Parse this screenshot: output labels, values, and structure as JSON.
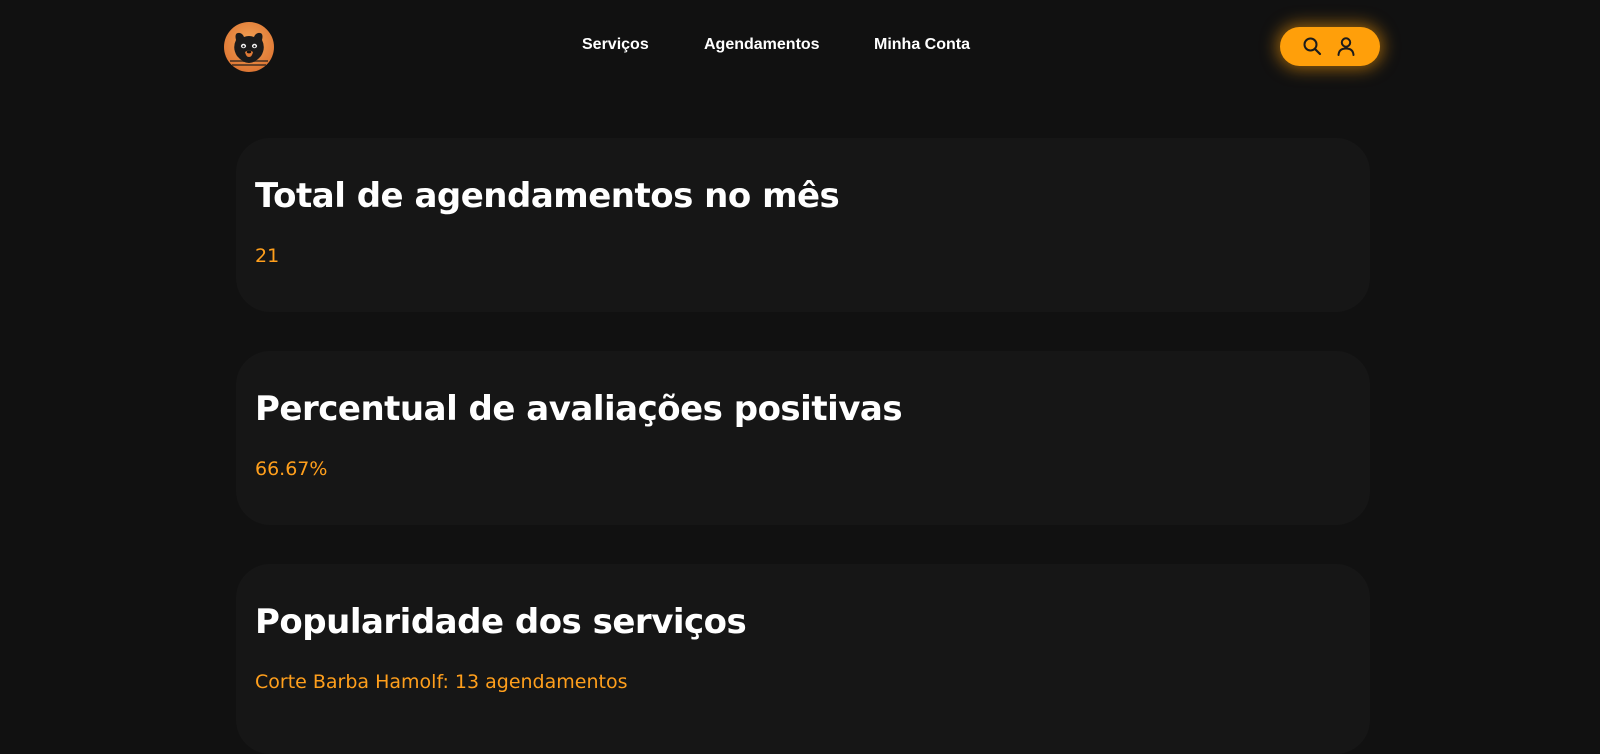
{
  "header": {
    "logo_icon": "bear-logo-icon",
    "nav": [
      {
        "label": "Serviços"
      },
      {
        "label": "Agendamentos"
      },
      {
        "label": "Minha Conta"
      }
    ],
    "actions": {
      "search_icon": "search-icon",
      "user_icon": "user-icon",
      "pill_color": "#ff9f0a"
    }
  },
  "cards": [
    {
      "title": "Total de agendamentos no mês",
      "value": "21"
    },
    {
      "title": "Percentual de avaliações positivas",
      "value": "66.67%"
    },
    {
      "title": "Popularidade dos serviços",
      "value": "Corte Barba Hamolf: 13 agendamentos"
    }
  ],
  "colors": {
    "background": "#111111",
    "card_background": "#161616",
    "accent": "#ff9f1c",
    "text": "#ffffff"
  }
}
